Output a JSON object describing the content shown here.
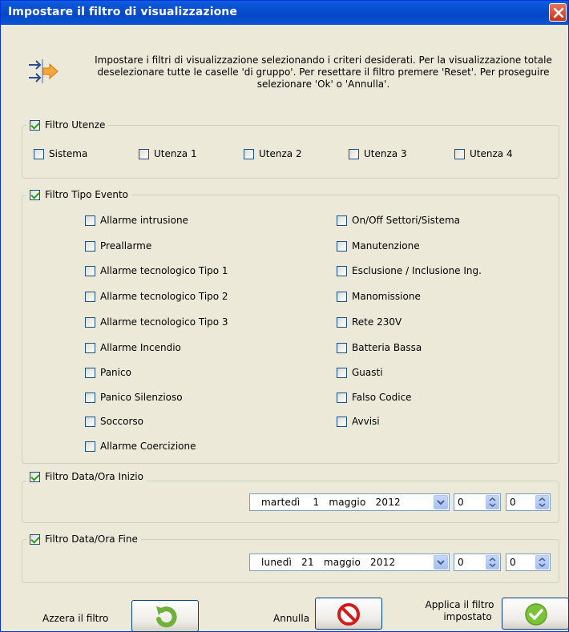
{
  "window": {
    "title": "Impostare il filtro di visualizzazione"
  },
  "info": {
    "icon": "filter-arrows-icon",
    "text": "Impostare i filtri di visualizzazione selezionando i criteri desiderati. Per la visualizzazione totale deselezionare tutte le caselle 'di gruppo'. Per resettare il filtro premere 'Reset'. Per proseguire selezionare 'Ok' o 'Annulla'."
  },
  "utenze": {
    "label": "Filtro Utenze",
    "checked": true,
    "items": [
      {
        "label": "Sistema",
        "checked": false
      },
      {
        "label": "Utenza 1",
        "checked": false
      },
      {
        "label": "Utenza 2",
        "checked": false
      },
      {
        "label": "Utenza 3",
        "checked": false
      },
      {
        "label": "Utenza 4",
        "checked": false
      }
    ]
  },
  "tipo_evento": {
    "label": "Filtro Tipo Evento",
    "checked": true,
    "left": [
      {
        "label": "Allarme intrusione",
        "checked": false
      },
      {
        "label": "Preallarme",
        "checked": false
      },
      {
        "label": "Allarme tecnologico Tipo 1",
        "checked": false
      },
      {
        "label": "Allarme tecnologico Tipo 2",
        "checked": false
      },
      {
        "label": "Allarme tecnologico Tipo 3",
        "checked": false
      },
      {
        "label": "Allarme Incendio",
        "checked": false
      },
      {
        "label": "Panico",
        "checked": false
      },
      {
        "label": "Panico Silenzioso",
        "checked": false
      },
      {
        "label": "Soccorso",
        "checked": false
      },
      {
        "label": "Allarme Coercizione",
        "checked": false
      }
    ],
    "right": [
      {
        "label": "On/Off Settori/Sistema",
        "checked": false
      },
      {
        "label": "Manutenzione",
        "checked": false
      },
      {
        "label": "Esclusione / Inclusione Ing.",
        "checked": false
      },
      {
        "label": "Manomissione",
        "checked": false
      },
      {
        "label": "Rete 230V",
        "checked": false
      },
      {
        "label": "Batteria Bassa",
        "checked": false
      },
      {
        "label": "Guasti",
        "checked": false
      },
      {
        "label": "Falso Codice",
        "checked": false
      },
      {
        "label": "Avvisi",
        "checked": false
      }
    ]
  },
  "inizio": {
    "label": "Filtro Data/Ora Inizio",
    "checked": true,
    "date": "martedì    1   maggio   2012",
    "hour": "0",
    "minute": "0"
  },
  "fine": {
    "label": "Filtro Data/Ora Fine",
    "checked": true,
    "date": "lunedì   21   maggio   2012",
    "hour": "0",
    "minute": "0"
  },
  "buttons": {
    "reset_label": "Azzera il filtro",
    "cancel_label": "Annulla",
    "apply_label_1": "Applica il filtro",
    "apply_label_2": "impostato"
  },
  "colors": {
    "titlebar": "#0A5FE0",
    "dialog_bg": "#ECE9D8",
    "check_green": "#21A121"
  }
}
